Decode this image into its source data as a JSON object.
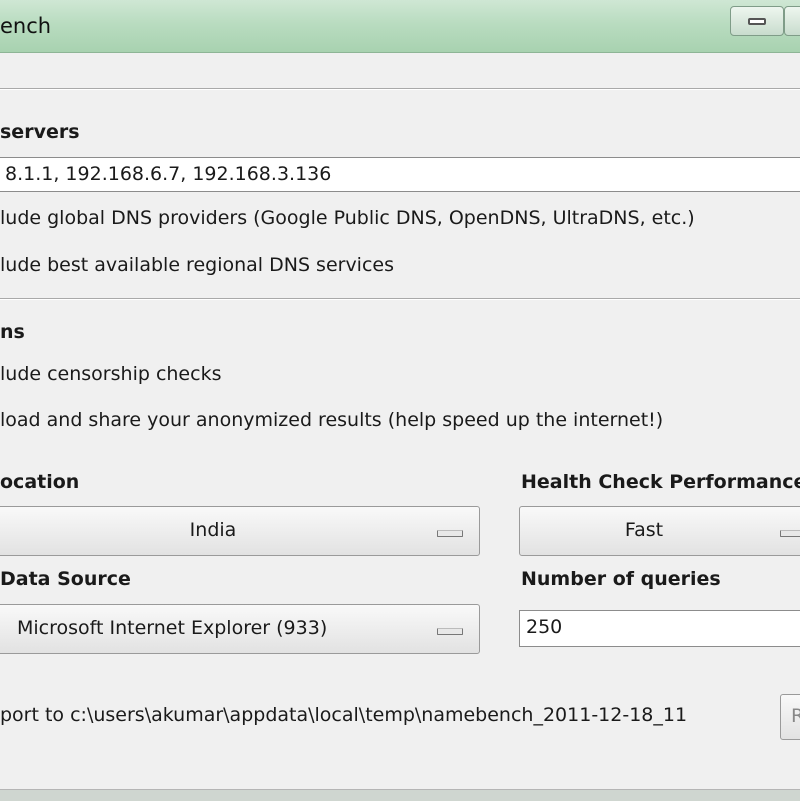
{
  "window": {
    "title": "ench"
  },
  "nameservers": {
    "heading": "servers",
    "value": "8.1.1, 192.168.6.7, 192.168.3.136",
    "include_global_label": "lude global DNS providers (Google Public DNS, OpenDNS, UltraDNS, etc.)",
    "include_regional_label": "lude best available regional DNS services"
  },
  "options": {
    "heading": "ns",
    "censorship_label": "lude censorship checks",
    "upload_label": "load and share your anonymized results (help speed up the internet!)"
  },
  "location": {
    "heading": "ocation",
    "value": "India"
  },
  "health_check": {
    "heading": "Health Check Performance",
    "value": "Fast"
  },
  "data_source": {
    "heading": "Data Source",
    "value": "Microsoft Internet Explorer (933)"
  },
  "queries": {
    "heading": "Number of queries",
    "value": "250"
  },
  "report": {
    "label": "port to c:\\users\\akumar\\appdata\\local\\temp\\namebench_2011-12-18_11"
  },
  "action_button": {
    "label": "R"
  }
}
